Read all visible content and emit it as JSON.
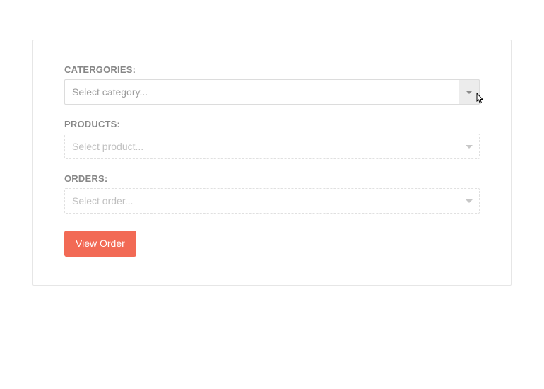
{
  "form": {
    "categories": {
      "label": "CATERGORIES:",
      "placeholder": "Select category...",
      "disabled": false
    },
    "products": {
      "label": "PRODUCTS:",
      "placeholder": "Select product...",
      "disabled": true
    },
    "orders": {
      "label": "ORDERS:",
      "placeholder": "Select order...",
      "disabled": true
    },
    "viewButton": "View Order"
  }
}
